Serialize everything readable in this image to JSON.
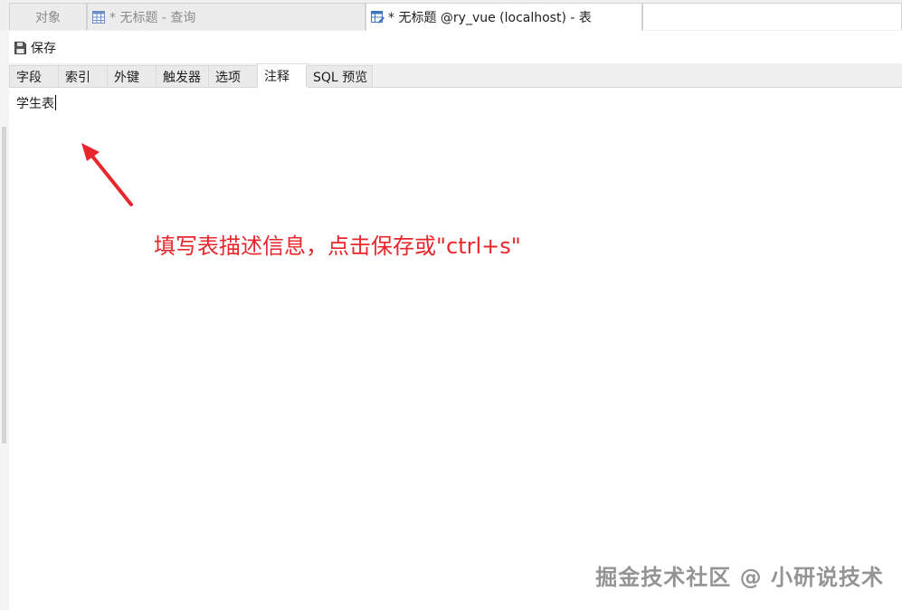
{
  "doc_tabs": {
    "objects": "对象",
    "query": "* 无标题 - 查询",
    "table": "* 无标题 @ry_vue (localhost) - 表"
  },
  "toolbar": {
    "save_label": "保存"
  },
  "inner_tabs": [
    {
      "label": "字段"
    },
    {
      "label": "索引"
    },
    {
      "label": "外键"
    },
    {
      "label": "触发器"
    },
    {
      "label": "选项"
    },
    {
      "label": "注释",
      "active": true
    },
    {
      "label": "SQL 预览"
    }
  ],
  "editor": {
    "comment_value": "学生表"
  },
  "annotation": {
    "text": "填写表描述信息，点击保存或\"ctrl+s\"",
    "color": "#e8262b"
  },
  "watermark": {
    "text": "掘金技术社区 @ 小研说技术"
  },
  "icons": {
    "query_tab": "query-grid-icon",
    "table_tab": "table-edit-icon",
    "save": "save-disk-icon"
  }
}
